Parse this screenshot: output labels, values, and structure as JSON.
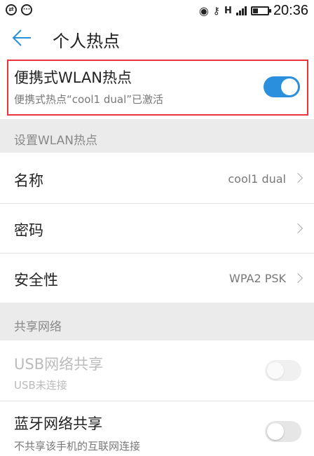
{
  "status_bar": {
    "time": "20:36",
    "network_type": "H",
    "battery_level": 0.35
  },
  "app_bar": {
    "back_icon": "arrow-left-icon",
    "title": "个人热点"
  },
  "hotspot": {
    "title": "便携式WLAN热点",
    "subtitle": "便携式热点“cool1 dual”已激活",
    "enabled": true
  },
  "section_wlan": {
    "label": "设置WLAN热点",
    "items": [
      {
        "label": "名称",
        "value": "cool1 dual"
      },
      {
        "label": "密码",
        "value": ""
      },
      {
        "label": "安全性",
        "value": "WPA2 PSK"
      }
    ]
  },
  "section_share": {
    "label": "共享网络",
    "usb": {
      "title": "USB网络共享",
      "subtitle": "USB未连接",
      "enabled": false,
      "disabled": true
    },
    "bluetooth": {
      "title": "蓝牙网络共享",
      "subtitle": "不共享该手机的互联网连接",
      "enabled": false
    }
  },
  "colors": {
    "accent": "#2a8fdc",
    "highlight_border": "#e8343a",
    "section_bg": "#ebebeb"
  }
}
